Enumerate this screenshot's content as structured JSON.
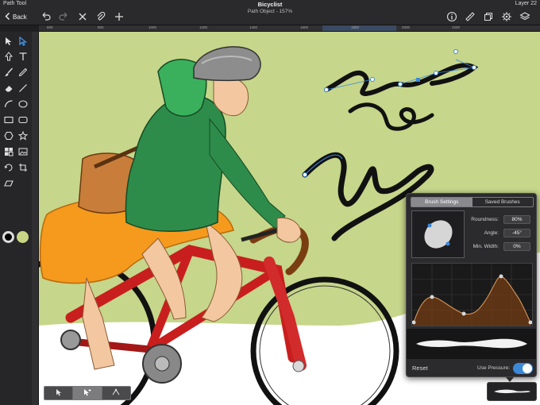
{
  "header": {
    "tool_name": "Path Tool",
    "doc_title": "Bicyclist",
    "doc_subtitle": "Path Object - 157%",
    "layer_name": "Layer 22",
    "back_label": "Back"
  },
  "ruler": {
    "ticks": [
      "600",
      "800",
      "1000",
      "1200",
      "1400",
      "1600",
      "1800",
      "2000",
      "2200"
    ]
  },
  "colors": {
    "stroke": "#000000",
    "fill": "#c8d685",
    "accent": "#3b88d9"
  },
  "toolbar_icons": [
    "select-arrow",
    "direct-select",
    "node-tool",
    "text",
    "brush",
    "pencil",
    "eraser",
    "line",
    "arc",
    "ellipse",
    "rectangle",
    "rounded-rectangle",
    "polygon",
    "star",
    "shapes",
    "image",
    "transform",
    "crop",
    "skew"
  ],
  "brush_panel": {
    "tabs": [
      {
        "label": "Brush Settings",
        "active": true
      },
      {
        "label": "Saved Brushes",
        "active": false
      }
    ],
    "properties": [
      {
        "label": "Roundness:",
        "value": "80%"
      },
      {
        "label": "Angle:",
        "value": "-45°"
      },
      {
        "label": "Min. Width:",
        "value": "0%"
      }
    ],
    "reset_label": "Reset",
    "pressure_label": "Use Pressure:",
    "use_pressure": true
  }
}
